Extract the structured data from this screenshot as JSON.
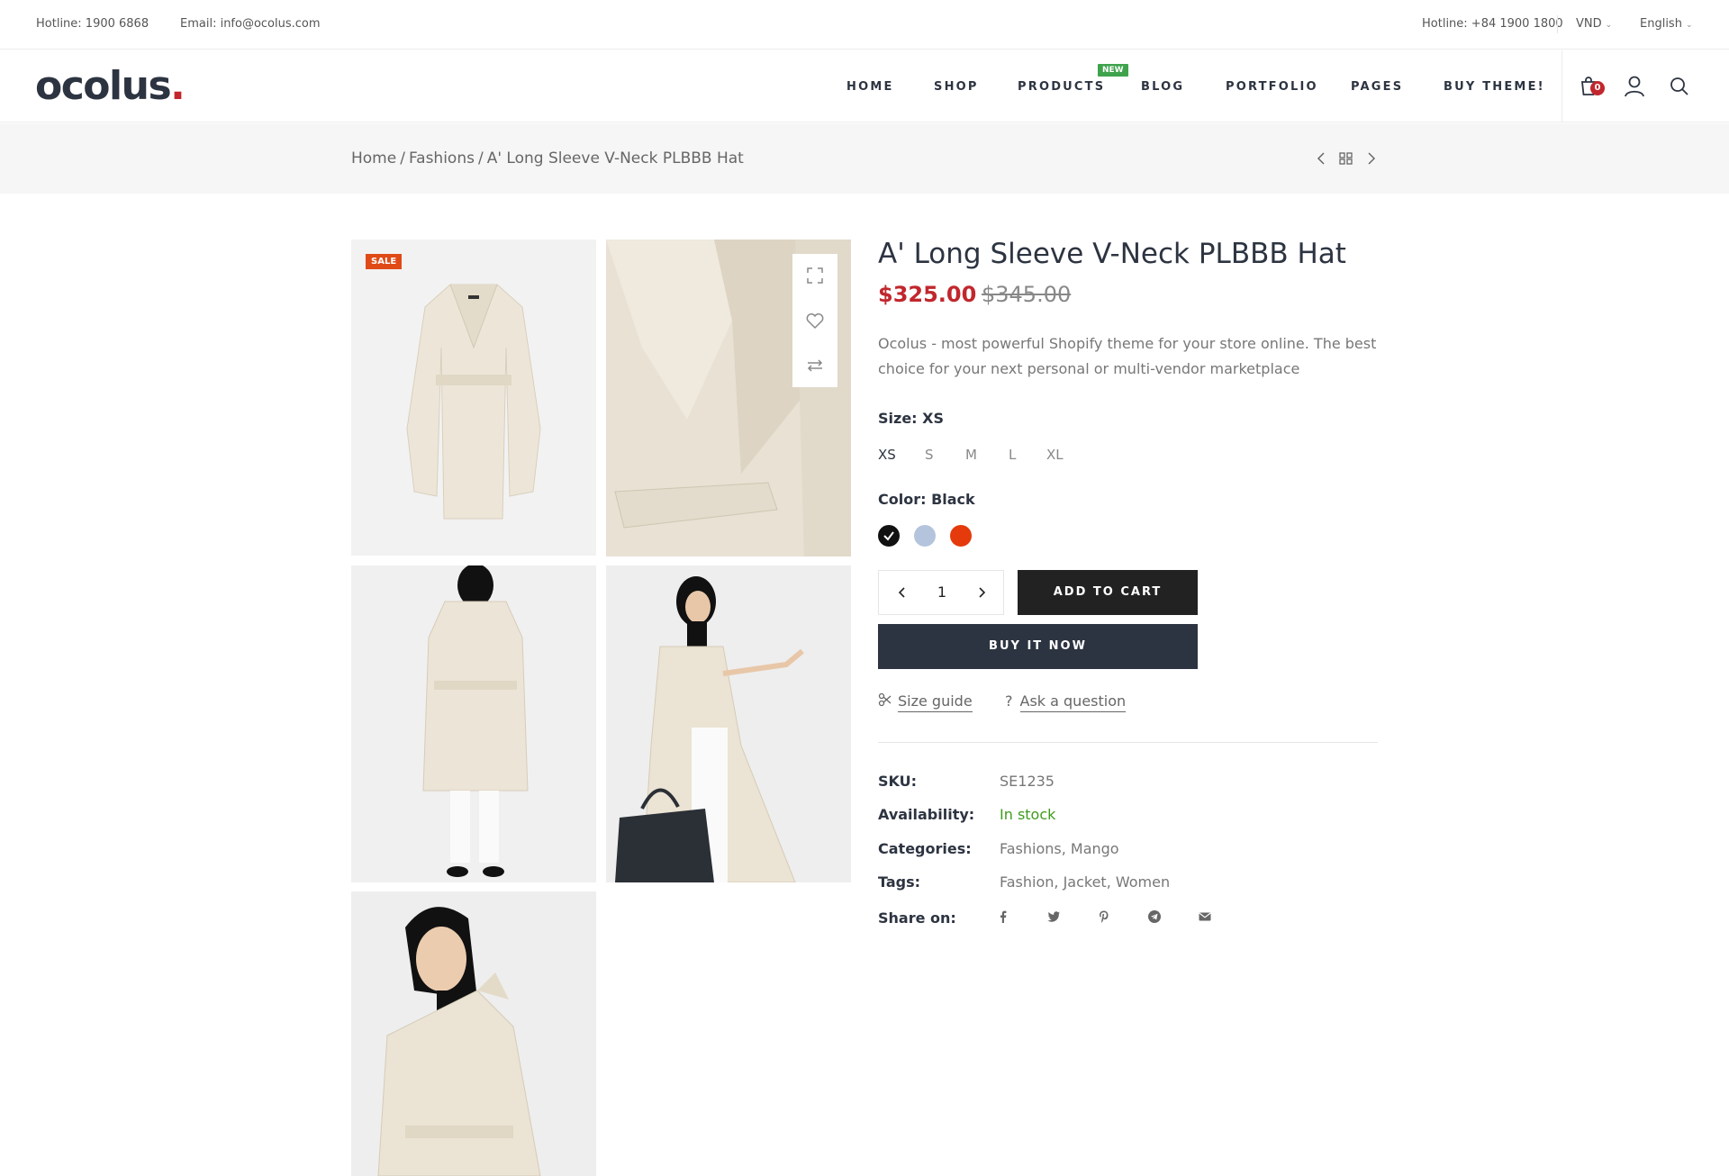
{
  "topbar": {
    "hotline_left": "Hotline: 1900 6868",
    "email": "Email: info@ocolus.com",
    "hotline_right": "Hotline: +84 1900 1800",
    "currency": "VND",
    "language": "English"
  },
  "header": {
    "logo": "ocolus",
    "logo_dot": ".",
    "nav": [
      "HOME",
      "SHOP",
      "PRODUCTS",
      "BLOG",
      "PORTFOLIO",
      "PAGES",
      "BUY THEME!"
    ],
    "new_badge": "NEW",
    "cart_count": "0",
    "icons": [
      "cart-icon",
      "user-icon",
      "search-icon"
    ]
  },
  "breadcrumb": {
    "items": [
      "Home",
      "Fashions",
      "A' Long Sleeve V-Neck PLBBB Hat"
    ],
    "separator": "/"
  },
  "gallery": {
    "sale_badge": "SALE",
    "tools": [
      "expand-icon",
      "heart-icon",
      "compare-icon"
    ]
  },
  "product": {
    "title": "A' Long Sleeve V-Neck PLBBB Hat",
    "price": "$325.00",
    "old_price": "$345.00",
    "description": "Ocolus - most powerful Shopify theme for your store online. The best choice for your next personal or multi-vendor marketplace",
    "size_label": "Size:",
    "size_value": "XS",
    "sizes": [
      "XS",
      "S",
      "M",
      "L",
      "XL"
    ],
    "color_label": "Color:",
    "color_value": "Black",
    "colors": [
      "#111111",
      "#b4c4dc",
      "#e53a0b"
    ],
    "quantity": "1",
    "add_to_cart": "ADD TO CART",
    "buy_now": "BUY IT NOW",
    "size_guide": "Size guide",
    "ask_question": "Ask a question",
    "ask_icon": "?"
  },
  "meta": {
    "sku_label": "SKU:",
    "sku": "SE1235",
    "availability_label": "Availability:",
    "availability": "In stock",
    "categories_label": "Categories:",
    "categories": "Fashions, Mango",
    "tags_label": "Tags:",
    "tags": "Fashion, Jacket, Women",
    "share_label": "Share on:",
    "share_icons": [
      "facebook-icon",
      "twitter-icon",
      "pinterest-icon",
      "telegram-icon",
      "email-icon"
    ]
  },
  "colors": {
    "primary": "#2d3441",
    "accent_red": "#c1272d",
    "sale_orange": "#e04a17",
    "new_green": "#3fa34d",
    "stock_green": "#3f9b1c"
  }
}
